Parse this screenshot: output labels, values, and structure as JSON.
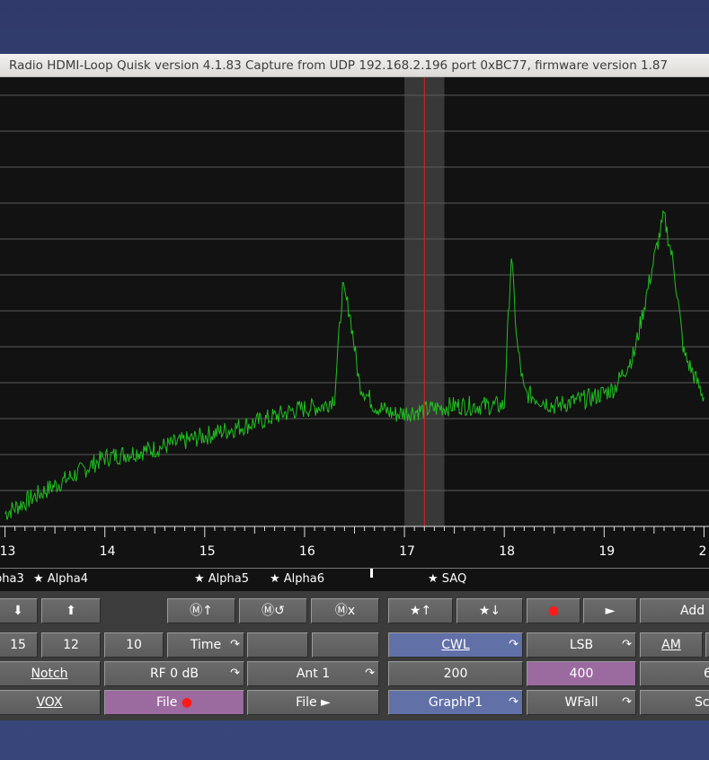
{
  "window": {
    "title": "Radio HDMI-Loop   Quisk version 4.1.83   Capture from UDP 192.168.2.196 port 0xBC77, firmware version 1.87"
  },
  "graph": {
    "x_ticks": [
      "13",
      "14",
      "15",
      "16",
      "17",
      "18",
      "19",
      "2"
    ],
    "stations": [
      "pha3",
      "★ Alpha4",
      "★ Alpha5",
      "★ Alpha6",
      "★ SAQ"
    ]
  },
  "chart_data": {
    "type": "line",
    "xlabel": "",
    "ylabel": "",
    "x_unit": "kHz",
    "xlim": [
      12.95,
      20.05
    ],
    "grid": true,
    "tuned_frequency": 17.2,
    "filter_band": [
      17.0,
      17.4
    ],
    "colors": {
      "trace": "#20c020",
      "tune_line": "#e02020",
      "filter_band": "#383838",
      "background": "#121212",
      "grid": "#5a5a5a"
    },
    "series": [
      {
        "values": [
          [
            13.0,
            0.03
          ],
          [
            13.3,
            0.07
          ],
          [
            13.7,
            0.12
          ],
          [
            14.0,
            0.16
          ],
          [
            14.5,
            0.18
          ],
          [
            15.0,
            0.21
          ],
          [
            15.5,
            0.24
          ],
          [
            15.9,
            0.27
          ],
          [
            16.2,
            0.28
          ],
          [
            16.3,
            0.3
          ],
          [
            16.38,
            0.55
          ],
          [
            16.45,
            0.5
          ],
          [
            16.55,
            0.33
          ],
          [
            16.7,
            0.28
          ],
          [
            16.9,
            0.26
          ],
          [
            17.2,
            0.27
          ],
          [
            17.5,
            0.28
          ],
          [
            18.0,
            0.28
          ],
          [
            18.07,
            0.63
          ],
          [
            18.13,
            0.42
          ],
          [
            18.2,
            0.31
          ],
          [
            18.5,
            0.28
          ],
          [
            18.9,
            0.3
          ],
          [
            19.1,
            0.32
          ],
          [
            19.3,
            0.4
          ],
          [
            19.5,
            0.62
          ],
          [
            19.6,
            0.72
          ],
          [
            19.7,
            0.6
          ],
          [
            19.8,
            0.4
          ],
          [
            20.0,
            0.3
          ]
        ]
      }
    ]
  },
  "controls": {
    "row1": {
      "down": "⬇",
      "up": "⬆",
      "mem_up": "Ⓜ↑",
      "mem_recall": "Ⓜ↺",
      "mem_delete": "Ⓜx",
      "star_up": "★↑",
      "star_down": "★↓",
      "record": "●",
      "play": "►",
      "add": "Add I"
    },
    "row2": {
      "b15": "15",
      "b12": "12",
      "b10": "10",
      "time": "Time",
      "empty1": "",
      "empty2": "",
      "cwl": "CWL",
      "lsb": "LSB",
      "am": "AM"
    },
    "row3": {
      "notch": "Notch",
      "rf": "RF 0 dB",
      "ant": "Ant 1",
      "bw200": "200",
      "bw400": "400",
      "bw6": "6"
    },
    "row4": {
      "vox": "VOX",
      "file_rec": "File",
      "file_play": "File ►",
      "graph": "GraphP1",
      "wfall": "WFall",
      "sc": "Sc"
    },
    "cycle_icon": "↷",
    "record_dot": "●"
  }
}
